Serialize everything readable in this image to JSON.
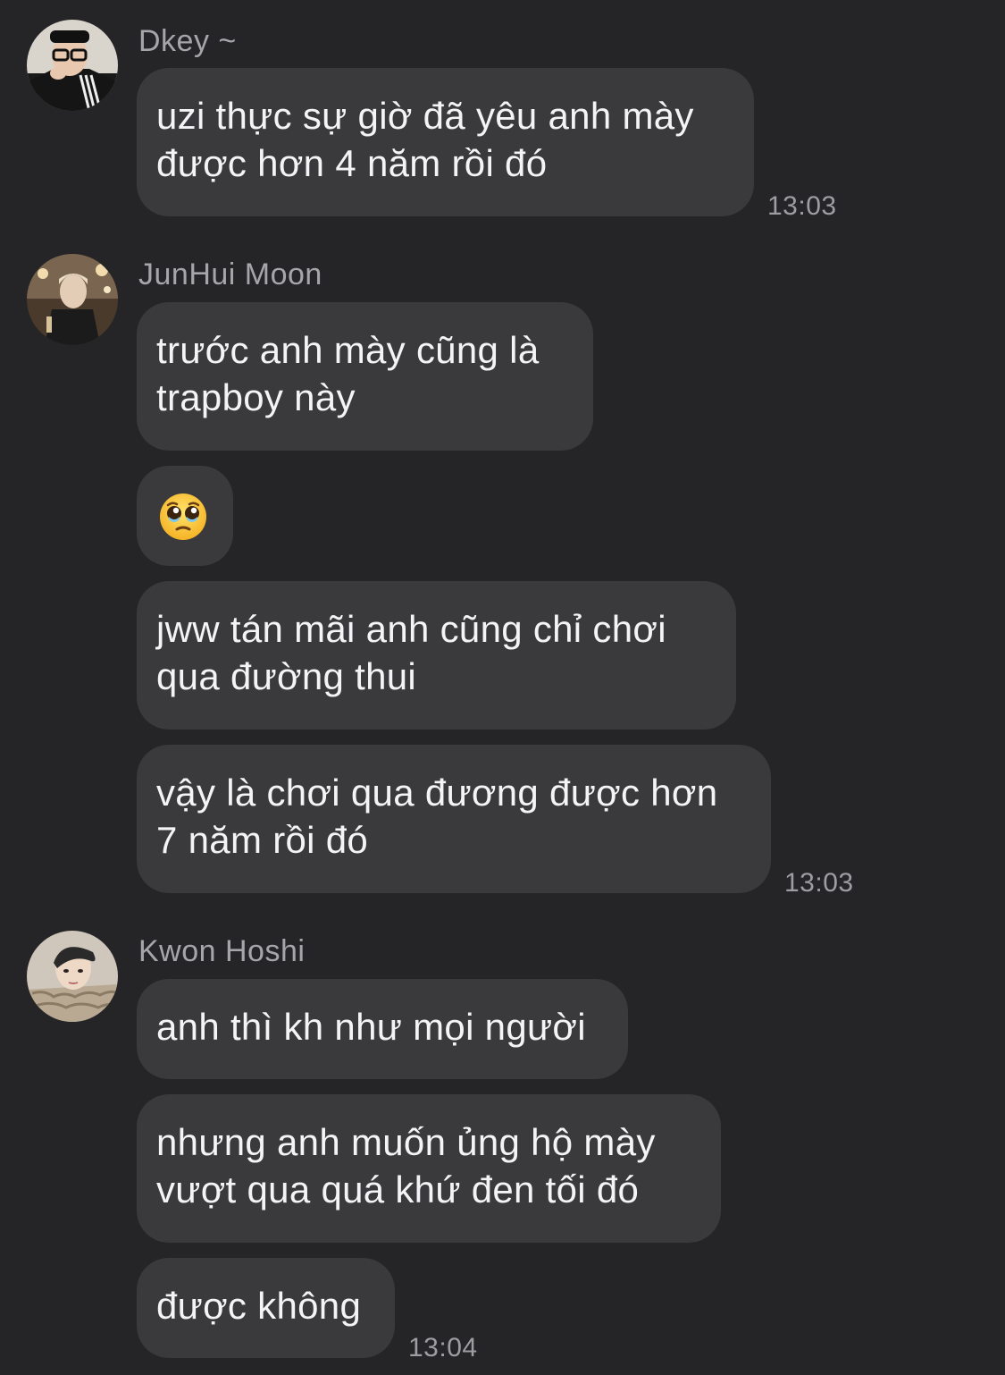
{
  "chat": {
    "groups": [
      {
        "sender": "Dkey ~",
        "avatar_icon": "avatar-dkey",
        "messages": [
          {
            "lines": [
              "uzi thực sự giờ đã yêu anh mày",
              "được hơn 4 năm rồi đó"
            ]
          }
        ],
        "time": "13:03"
      },
      {
        "sender": "JunHui Moon",
        "avatar_icon": "avatar-junhui",
        "messages": [
          {
            "lines": [
              "trước anh mày cũng là",
              "trapboy này"
            ]
          },
          {
            "emoji": "pleading-face-icon"
          },
          {
            "lines": [
              "jww tán mãi anh cũng chỉ chơi",
              "qua đường thui"
            ]
          },
          {
            "lines": [
              "vậy là chơi qua đương được hơn",
              "7 năm rồi đó"
            ]
          }
        ],
        "time": "13:03"
      },
      {
        "sender": "Kwon Hoshi",
        "avatar_icon": "avatar-hoshi",
        "messages": [
          {
            "lines": [
              "anh thì kh như mọi người"
            ]
          },
          {
            "lines": [
              "nhưng anh muốn ủng hộ mày",
              "vượt qua quá khứ đen tối đó"
            ]
          },
          {
            "lines": [
              "được không"
            ]
          }
        ],
        "time": "13:04"
      }
    ]
  },
  "colors": {
    "background": "#252527",
    "bubble": "#3a3a3d",
    "text": "#f4f4f6",
    "meta": "#a5a5aa"
  }
}
